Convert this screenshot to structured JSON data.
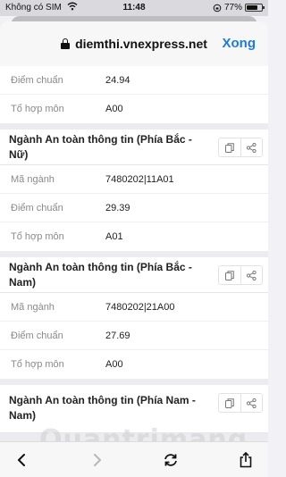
{
  "status_bar": {
    "carrier": "Không có SIM",
    "time": "11:48",
    "battery_percent": "77%",
    "battery_level": 0.77
  },
  "browser": {
    "url": "diemthi.vnexpress.net",
    "done_label": "Xong"
  },
  "labels": {
    "major_code": "Mã ngành",
    "cutoff_score": "Điểm chuẩn",
    "subject_group": "Tổ hợp môn"
  },
  "cards": [
    {
      "title": "",
      "rows": [
        {
          "label": "Điểm chuẩn",
          "value": "24.94"
        },
        {
          "label": "Tổ hợp môn",
          "value": "A00"
        }
      ]
    },
    {
      "title": "Ngành An toàn thông tin (Phía Bắc - Nữ)",
      "rows": [
        {
          "label": "Mã ngành",
          "value": "7480202|11A01"
        },
        {
          "label": "Điểm chuẩn",
          "value": "29.39"
        },
        {
          "label": "Tổ hợp môn",
          "value": "A01"
        }
      ]
    },
    {
      "title": "Ngành An toàn thông tin (Phía Bắc - Nam)",
      "rows": [
        {
          "label": "Mã ngành",
          "value": "7480202|21A00"
        },
        {
          "label": "Điểm chuẩn",
          "value": "27.69"
        },
        {
          "label": "Tổ hợp môn",
          "value": "A00"
        }
      ]
    },
    {
      "title": "Ngành An toàn thông tin (Phía Nam - Nam)",
      "rows": []
    }
  ],
  "watermark": "Quantrimang",
  "icons": {
    "copy": "copy-icon",
    "share": "share-icon",
    "back": "chevron-left-icon",
    "forward": "chevron-right-icon",
    "reload": "reload-icon",
    "share_sheet": "share-sheet-icon"
  },
  "colors": {
    "accent": "#1f7ae0"
  }
}
